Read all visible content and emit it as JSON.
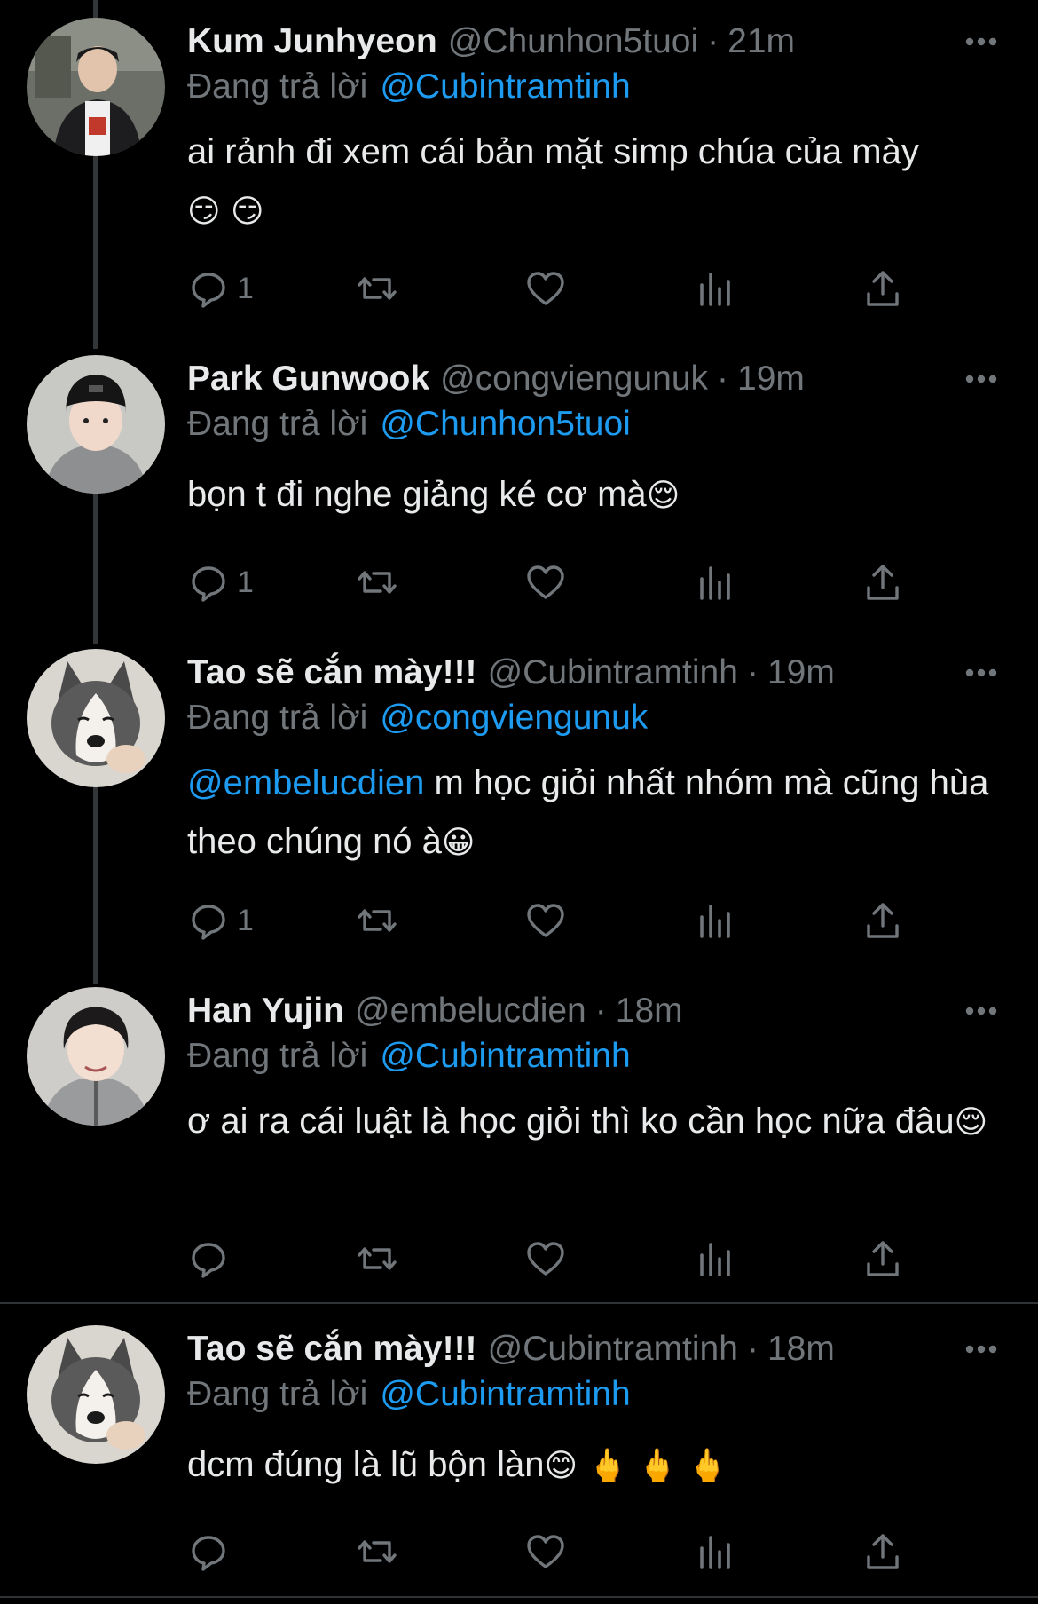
{
  "colors": {
    "background": "#000000",
    "primary_text": "#e7e9ea",
    "secondary_text": "#71767b",
    "link": "#1d9bf0",
    "thread_line": "#333639"
  },
  "tweets": [
    {
      "name": "Kum Junhyeon",
      "handle": "@Chunhon5tuoi",
      "dot": "·",
      "time": "21m",
      "reply_prefix": "Đang trả lời",
      "reply_to": "@Cubintramtinh",
      "mention": "",
      "text": "ai rảnh đi xem cái bản mặt simp chúa của mày",
      "emoji": "😏 😏",
      "reply_count": "1",
      "avatar": "person-avatar"
    },
    {
      "name": "Park Gunwook",
      "handle": "@congviengunuk",
      "dot": "·",
      "time": "19m",
      "reply_prefix": "Đang trả lời",
      "reply_to": "@Chunhon5tuoi",
      "mention": "",
      "text": "bọn t đi nghe giảng ké cơ mà",
      "emoji": "😌",
      "reply_count": "1",
      "avatar": "person-avatar"
    },
    {
      "name": "Tao sẽ cắn mày!!!",
      "handle": "@Cubintramtinh",
      "dot": "·",
      "time": "19m",
      "reply_prefix": "Đang trả lời",
      "reply_to": "@congviengunuk",
      "mention": "@embelucdien",
      "text": " m học giỏi nhất nhóm mà cũng hùa theo chúng nó à",
      "emoji": "😀",
      "reply_count": "1",
      "avatar": "dog-avatar"
    },
    {
      "name": "Han Yujin",
      "handle": "@embelucdien",
      "dot": "·",
      "time": "18m",
      "reply_prefix": "Đang trả lời",
      "reply_to": "@Cubintramtinh",
      "mention": "",
      "text": "ơ ai ra cái luật là học giỏi thì ko cần học nữa đâu",
      "emoji": "😌",
      "reply_count": "",
      "avatar": "person-avatar"
    },
    {
      "name": "Tao sẽ cắn mày!!!",
      "handle": "@Cubintramtinh",
      "dot": "·",
      "time": "18m",
      "reply_prefix": "Đang trả lời",
      "reply_to": "@Cubintramtinh",
      "mention": "",
      "text": "dcm đúng là lũ bộn làn",
      "emoji": "😊 🖕 🖕 🖕",
      "reply_count": "",
      "avatar": "dog-avatar"
    }
  ],
  "icons": {
    "more": "more-horizontal-icon",
    "reply": "reply-bubble-icon",
    "retweet": "retweet-icon",
    "like": "heart-icon",
    "analytics": "analytics-bars-icon",
    "share": "share-upload-icon"
  }
}
